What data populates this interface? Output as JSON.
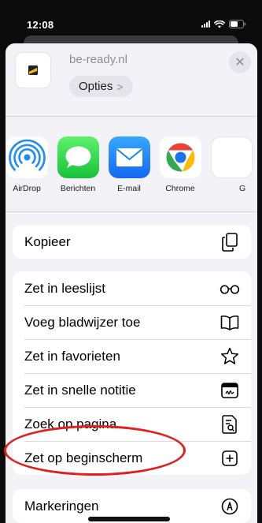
{
  "status_bar": {
    "time": "12:08"
  },
  "header": {
    "domain": "be-ready.nl",
    "options_label": "Opties",
    "options_chevron": ">",
    "close_glyph": "✕"
  },
  "apps": [
    {
      "label": "AirDrop",
      "icon": "airdrop-icon",
      "color": "#1b8cf8"
    },
    {
      "label": "Berichten",
      "icon": "messages-icon",
      "color": "#34c759"
    },
    {
      "label": "E-mail",
      "icon": "mail-icon",
      "color": "#1a82fb"
    },
    {
      "label": "Chrome",
      "icon": "chrome-icon",
      "color": "#ea4335"
    },
    {
      "label": "G",
      "icon": "more-app-icon",
      "color": "#ffffff"
    }
  ],
  "actions_group1": [
    {
      "label": "Kopieer",
      "icon": "copy-icon"
    }
  ],
  "actions_group2": [
    {
      "label": "Zet in leeslijst",
      "icon": "glasses-icon"
    },
    {
      "label": "Voeg bladwijzer toe",
      "icon": "book-icon"
    },
    {
      "label": "Zet in favorieten",
      "icon": "star-icon"
    },
    {
      "label": "Zet in snelle notitie",
      "icon": "quick-note-icon"
    },
    {
      "label": "Zoek op pagina",
      "icon": "find-on-page-icon"
    },
    {
      "label": "Zet op beginscherm",
      "icon": "add-square-icon"
    }
  ],
  "actions_group3": [
    {
      "label": "Markeringen",
      "icon": "markup-icon"
    }
  ],
  "annotation_color": "#e0201f"
}
